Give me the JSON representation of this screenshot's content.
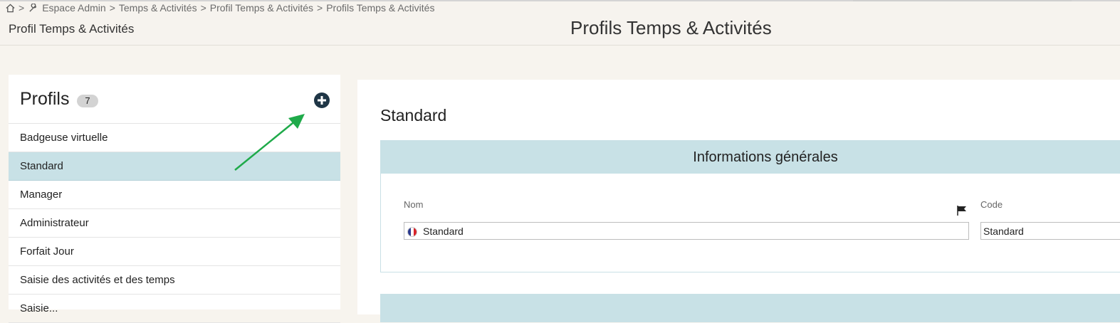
{
  "breadcrumb": {
    "items": [
      "Espace Admin",
      "Temps & Activités",
      "Profil Temps & Activités",
      "Profils Temps & Activités"
    ],
    "separator": ">"
  },
  "header": {
    "subtitle": "Profil Temps & Activités",
    "title": "Profils Temps & Activités"
  },
  "profiles": {
    "title": "Profils",
    "count": "7",
    "items": [
      {
        "label": "Badgeuse virtuelle"
      },
      {
        "label": "Standard",
        "selected": true
      },
      {
        "label": "Manager"
      },
      {
        "label": "Administrateur"
      },
      {
        "label": "Forfait Jour"
      },
      {
        "label": "Saisie des activités et des temps"
      },
      {
        "label": "Saisie..."
      }
    ]
  },
  "detail": {
    "title": "Standard",
    "section_title": "Informations générales",
    "nom_label": "Nom",
    "nom_value": "Standard",
    "code_label": "Code",
    "code_value": "Standard"
  },
  "icons": {
    "home": "home-icon",
    "wrench": "wrench-icon",
    "add": "plus-circle-icon",
    "flag": "flag-icon",
    "language": "french-flag-icon"
  },
  "colors": {
    "accent": "#c8e1e6",
    "add_button": "#1f3646",
    "annotation_arrow": "#1faa4a"
  }
}
